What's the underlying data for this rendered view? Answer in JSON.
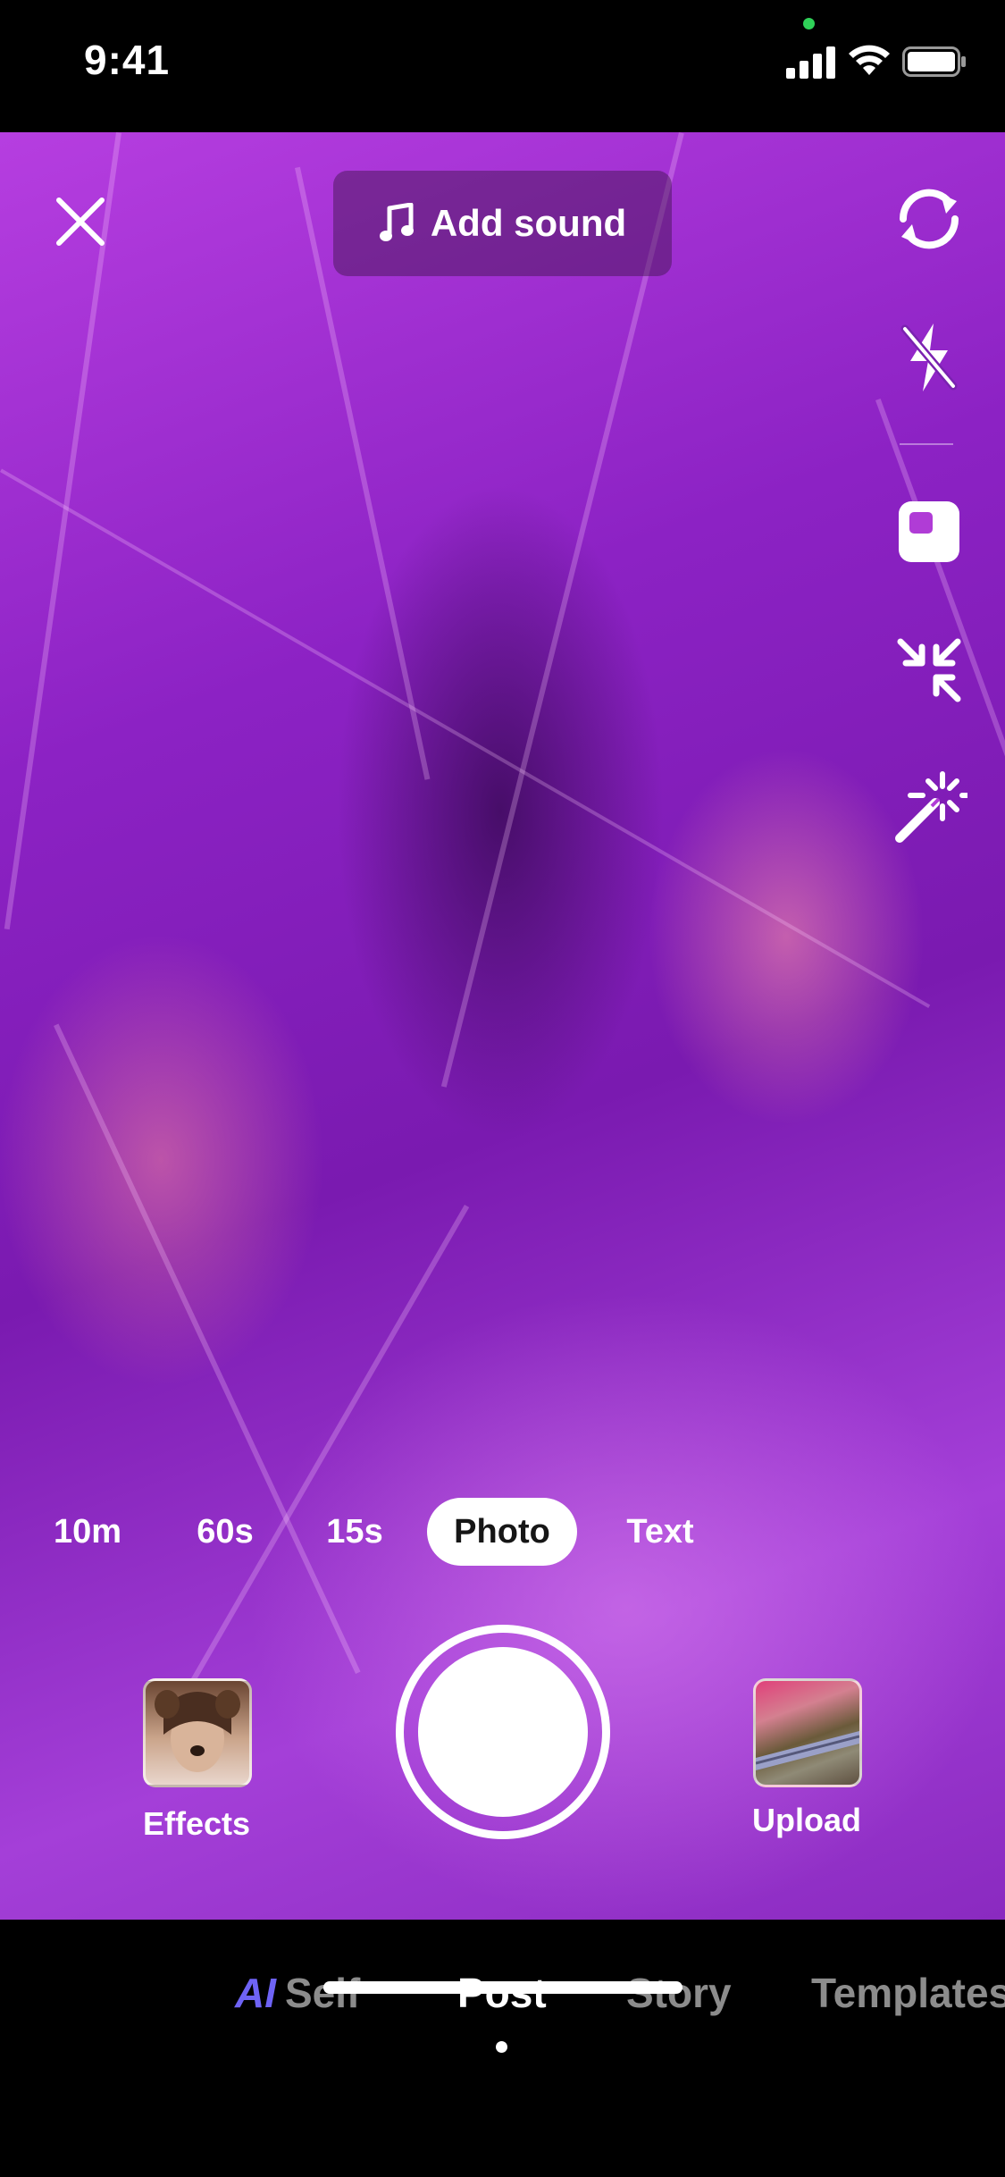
{
  "status_bar": {
    "time": "9:41",
    "signal_icon": "cellular-signal-icon",
    "wifi_icon": "wifi-icon",
    "battery_icon": "battery-icon"
  },
  "top_bar": {
    "close_icon": "close-icon",
    "add_sound_label": "Add sound",
    "music_icon": "music-note-icon"
  },
  "right_tools": [
    {
      "name": "flip-camera-icon"
    },
    {
      "name": "flash-off-icon"
    },
    {
      "name": "timer-square-icon"
    },
    {
      "name": "shrink-icon"
    },
    {
      "name": "enhance-wand-icon"
    }
  ],
  "modes": {
    "items": [
      "10m",
      "60s",
      "15s",
      "Photo",
      "Text"
    ],
    "selected": "Photo"
  },
  "capture": {
    "effects_label": "Effects",
    "upload_label": "Upload"
  },
  "bottom_tabs": {
    "ai_self_prefix": "AI",
    "ai_self_label": "Self",
    "post_label": "Post",
    "story_label": "Story",
    "templates_label": "Templates",
    "selected": "Post"
  },
  "colors": {
    "accent_ai": "#6e63f5",
    "status_dot": "#2fd158"
  }
}
